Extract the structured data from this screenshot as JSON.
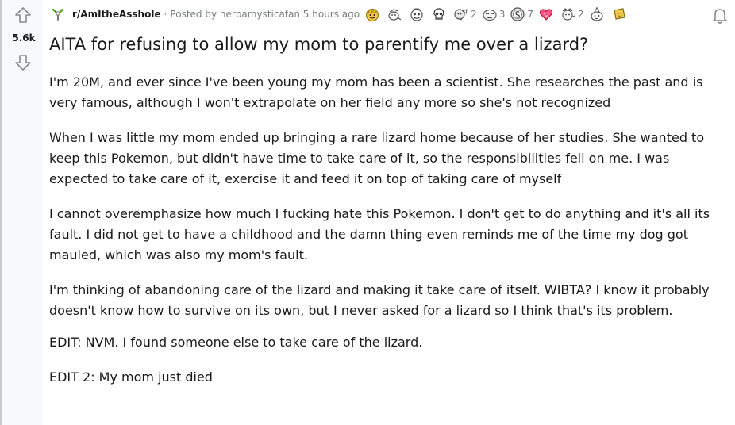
{
  "vote": {
    "score": "5.6k"
  },
  "post": {
    "subreddit": "r/AmItheAsshole",
    "separator": "·",
    "posted_by": "Posted by herbamysticafan 5 hours ago",
    "title": "AITA for refusing to allow my mom to parentify me over a lizard?",
    "paragraphs": [
      "I'm 20M, and ever since I've been young my mom has been a scientist. She researches the past and is very famous, although I won't extrapolate on her field any more so she's not recognized",
      "When I was little my mom ended up bringing a rare lizard home because of her studies. She wanted to keep this Pokemon, but didn't have time to take care of it, so the responsibilities fell on me. I was expected to take care of it, exercise it and feed it on top of taking care of myself",
      "I cannot overemphasize how much I fucking hate this Pokemon. I don't get to do anything and it's all its fault. I did not get to have a childhood and the damn thing even reminds me of the time my dog got mauled, which was also my mom's fault.",
      "I'm thinking of abandoning care of the lizard and making it take care of itself. WIBTA? I know it probably doesn't know how to survive on its own, but I never asked for a lizard so I think that's its problem.",
      "EDIT: NVM. I found someone else to take care of the lizard.",
      "EDIT 2: My mom just died"
    ]
  },
  "awards": [
    {
      "icon": "gold-award-icon",
      "count": ""
    },
    {
      "icon": "wholesome-award-icon",
      "count": ""
    },
    {
      "icon": "helpful-award-icon",
      "count": ""
    },
    {
      "icon": "skull-award-icon",
      "count": ""
    },
    {
      "icon": "hugz-award-icon",
      "count": "2"
    },
    {
      "icon": "face-award-icon",
      "count": "3"
    },
    {
      "icon": "silver-award-icon",
      "count": "7"
    },
    {
      "icon": "heart-award-icon",
      "count": ""
    },
    {
      "icon": "hands-award-icon",
      "count": "2"
    },
    {
      "icon": "party-award-icon",
      "count": ""
    },
    {
      "icon": "ticket-award-icon",
      "count": ""
    }
  ],
  "colors": {
    "text": "#1a1a1b",
    "meta": "#787c7e",
    "rail": "#f8f9fa",
    "gold": "#f2c94c"
  }
}
